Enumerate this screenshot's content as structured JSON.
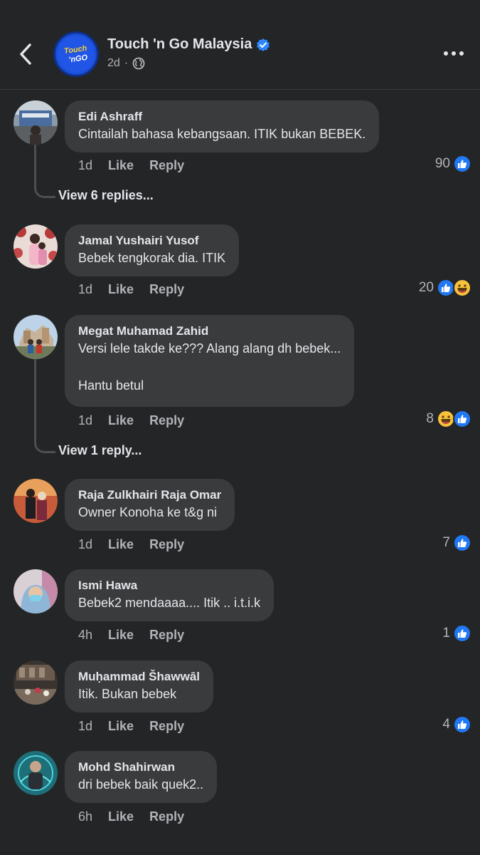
{
  "header": {
    "page_name": "Touch 'n Go Malaysia",
    "time": "2d",
    "separator": "·",
    "logo_text_top": "Touch",
    "logo_text_bottom": "'nGO",
    "icons": [
      "back-chevron-icon",
      "verified-badge-icon",
      "globe-icon",
      "more-dots-icon"
    ]
  },
  "colors": {
    "background": "#242526",
    "bubble": "#3a3b3c",
    "like_blue": "#2078f4",
    "haha_yellow": "#f7c13a",
    "verified_blue": "#2d88ff"
  },
  "comments": [
    {
      "author": "Edi Ashraff",
      "text": "Cintailah bahasa kebangsaan. ITIK bukan BEBEK.",
      "time": "1d",
      "like": "Like",
      "reply": "Reply",
      "count": "90",
      "reactions": [
        "like"
      ],
      "view_replies": "View 6 replies..."
    },
    {
      "author": "Jamal Yushairi Yusof",
      "text": "Bebek tengkorak dia. ITIK",
      "time": "1d",
      "like": "Like",
      "reply": "Reply",
      "count": "20",
      "reactions": [
        "like",
        "haha"
      ]
    },
    {
      "author": "Megat Muhamad Zahid",
      "text": "Versi lele takde ke??? Alang alang dh bebek...\n\nHantu betul",
      "time": "1d",
      "like": "Like",
      "reply": "Reply",
      "count": "8",
      "reactions": [
        "haha",
        "like"
      ],
      "view_replies": "View 1 reply..."
    },
    {
      "author": "Raja Zulkhairi Raja Omar",
      "text": "Owner Konoha ke t&g ni",
      "time": "1d",
      "like": "Like",
      "reply": "Reply",
      "count": "7",
      "reactions": [
        "like"
      ]
    },
    {
      "author": "Ismi Hawa",
      "text": "Bebek2 mendaaaa.... Itik .. i.t.i.k",
      "time": "4h",
      "like": "Like",
      "reply": "Reply",
      "count": "1",
      "reactions": [
        "like"
      ]
    },
    {
      "author": "Muḥammad Šhawwāl",
      "text": "Itik. Bukan bebek",
      "time": "1d",
      "like": "Like",
      "reply": "Reply",
      "count": "4",
      "reactions": [
        "like"
      ]
    },
    {
      "author": "Mohd Shahirwan",
      "text": "dri bebek baik quek2..",
      "time": "6h",
      "like": "Like",
      "reply": "Reply"
    }
  ]
}
